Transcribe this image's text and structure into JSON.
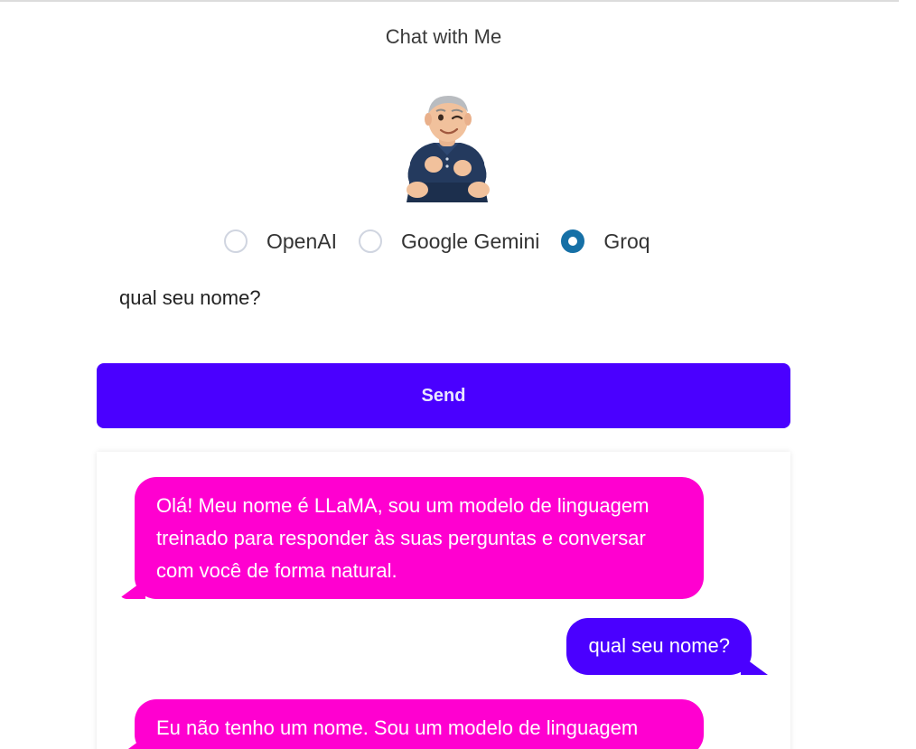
{
  "header": {
    "title": "Chat with Me"
  },
  "avatar": {
    "name": "avatar-memoji"
  },
  "providers": {
    "options": [
      "OpenAI",
      "Google Gemini",
      "Groq"
    ],
    "selected": "Groq"
  },
  "input": {
    "value": "qual seu nome?"
  },
  "send": {
    "label": "Send"
  },
  "messages": [
    {
      "role": "bot",
      "text": "Olá! Meu nome é LLaMA, sou um modelo de linguagem treinado para responder às suas perguntas e conversar com você de forma natural."
    },
    {
      "role": "user",
      "text": "qual seu nome?"
    },
    {
      "role": "bot",
      "text": "Eu não tenho um nome. Sou um modelo de linguagem"
    }
  ],
  "colors": {
    "accent": "#4a00ff",
    "bot_bubble": "#ff00d0",
    "radio_checked": "#1670a6"
  }
}
